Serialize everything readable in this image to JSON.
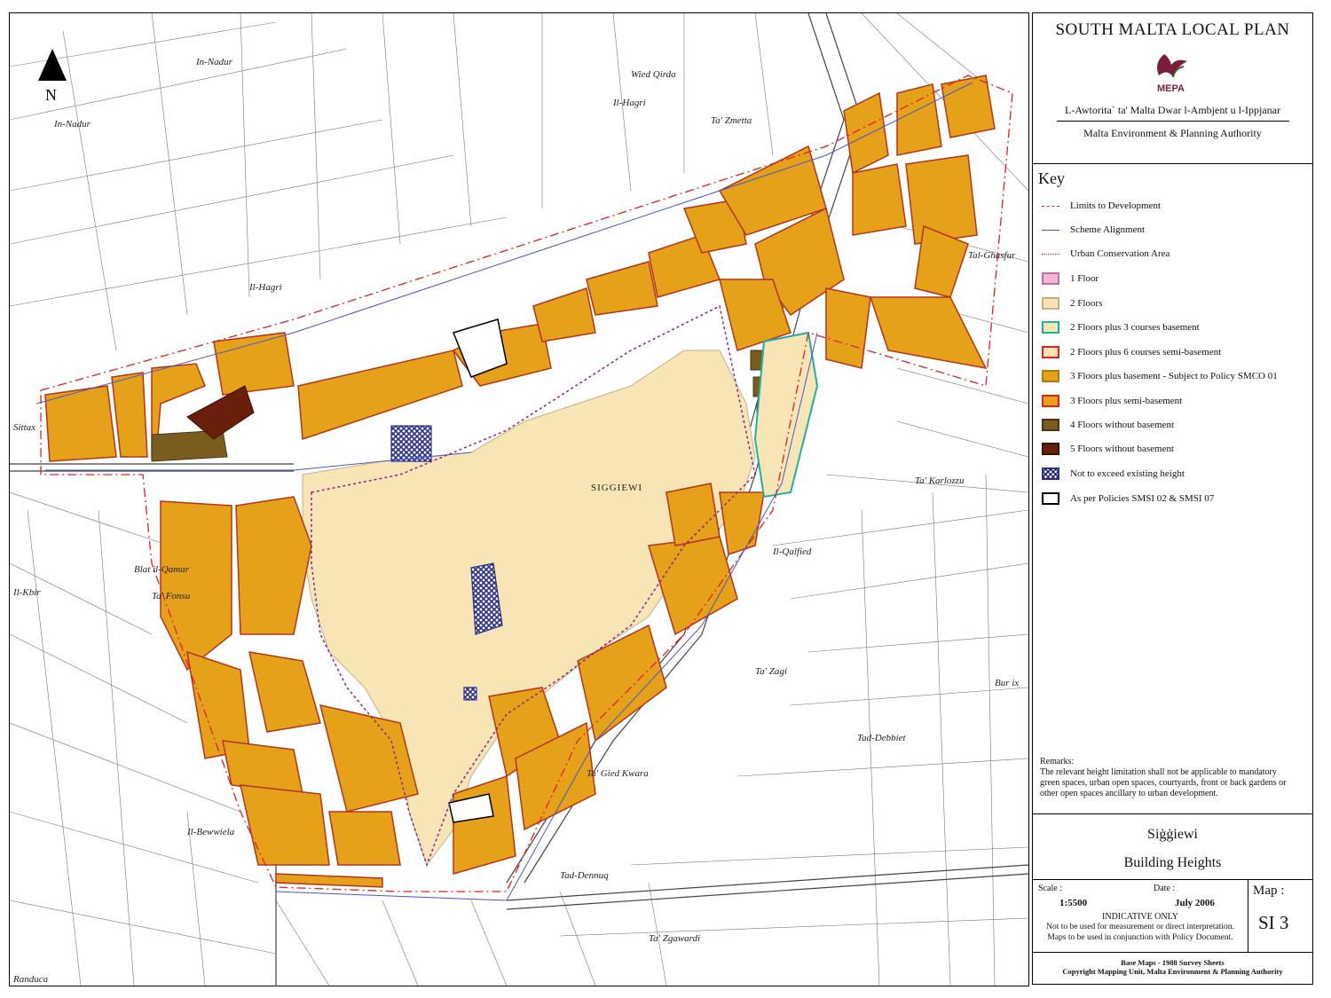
{
  "north_label": "N",
  "map": {
    "town_label": "SIGGIEWI",
    "places": [
      "In-Nadur",
      "In-Nadur",
      "Ta' Zmetta",
      "Il-Hagri",
      "Il-Hagri",
      "Sittax",
      "Blat il-Qamar",
      "Ta' Fonsu",
      "Il-Kbir",
      "Ta' Karlozzu",
      "Tal-Ghasfur",
      "Il-Qalfied",
      "Ta' Zagi",
      "Bur ix",
      "Tad-Debbiet",
      "Ta' Gied Kwara",
      "Il-Bewwiela",
      "Tad-Dennuq",
      "Ta' Zgawardi",
      "Randuca",
      "Wied Qirda"
    ],
    "colors": {
      "three_floors": "#E4A119",
      "two_floors": "#F7E5B5",
      "four_floors": "#7A5C1E",
      "five_floors": "#6A1F0A",
      "limit": "#E02020",
      "scheme": "#4A56C8",
      "uca": "#8A2290"
    }
  },
  "panel": {
    "title": "SOUTH MALTA LOCAL PLAN",
    "logo_text": "MEPA",
    "org_maltese": "L-Awtorita` ta' Malta Dwar l-Ambjent u l-Ippjanar",
    "org_english": "Malta Environment & Planning Authority",
    "key_title": "Key",
    "key_items": [
      {
        "label": "Limits to Development",
        "kind": "line",
        "color": "#E02020",
        "style": "dashdot"
      },
      {
        "label": "Scheme Alignment",
        "kind": "line",
        "color": "#4A56C8",
        "style": "solid"
      },
      {
        "label": "Urban Conservation Area",
        "kind": "line",
        "color": "#8A2290",
        "style": "dotted"
      },
      {
        "label": "1 Floor",
        "kind": "box",
        "fill": "#F4B6D8",
        "border": "#C070A0"
      },
      {
        "label": "2 Floors",
        "kind": "box",
        "fill": "#F7E5B5",
        "border": "#C9B080"
      },
      {
        "label": "2 Floors plus 3 courses basement",
        "kind": "box",
        "fill": "#F7E5B5",
        "border": "#20B0A0"
      },
      {
        "label": "2 Floors plus 6 courses semi-basement",
        "kind": "box",
        "fill": "#F7E5B5",
        "border": "#E02020"
      },
      {
        "label": "3 Floors plus basement - Subject to Policy SMCO 01",
        "kind": "box",
        "fill": "#E4A119",
        "border": "#B07810"
      },
      {
        "label": "3 Floors plus semi-basement",
        "kind": "box",
        "fill": "#E4A119",
        "border": "#E02020"
      },
      {
        "label": "4 Floors without basement",
        "kind": "box",
        "fill": "#7A5C1E",
        "border": "#4A3510"
      },
      {
        "label": "5 Floors without basement",
        "kind": "box",
        "fill": "#6A1F0A",
        "border": "#3A0E04"
      },
      {
        "label": "Not to exceed existing height",
        "kind": "hatch",
        "fill": "#2A2F8A",
        "border": "#2A2F8A"
      },
      {
        "label": "As per Policies SMSI 02 & SMSI 07",
        "kind": "box",
        "fill": "#FFFFFF",
        "border": "#000000"
      }
    ],
    "remarks_title": "Remarks:",
    "remarks_text": "The relevant height limitation shall not be applicable to mandatory green spaces, urban open spaces, courtyards, front or back gardens or other open spaces ancillary to urban development.",
    "locality": "Siġġiewi",
    "map_subject": "Building Heights",
    "scale_label": "Scale :",
    "scale_value": "1:5500",
    "date_label": "Date :",
    "date_value": "July 2006",
    "indicative": "INDICATIVE ONLY",
    "disclaimer_1": "Not to be used for measurement or direct interpretation.",
    "disclaimer_2": "Maps to be used in conjunction with Policy Document.",
    "map_label": "Map :",
    "map_id": "SI 3",
    "footer_1": "Base Maps - 1988 Survey Sheets",
    "footer_2": "Copyright Mapping Unit, Malta Environment & Planning Authority"
  }
}
